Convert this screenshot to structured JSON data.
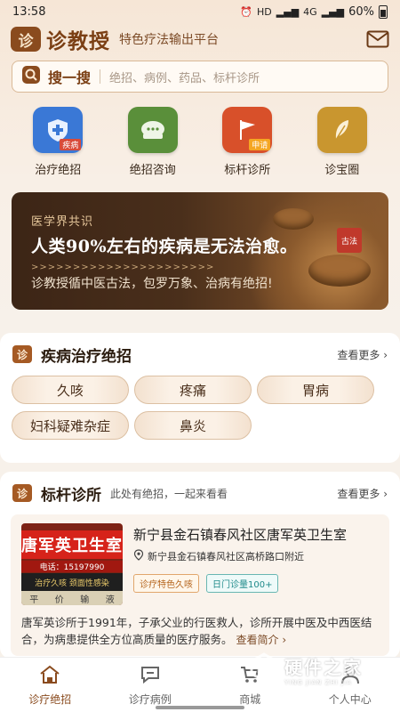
{
  "status_bar": {
    "time": "13:58",
    "net_hd": "HD",
    "net_4g": "4G",
    "battery": "60%"
  },
  "header": {
    "logo_char": "诊",
    "app_name": "诊教授",
    "slogan": "特色疗法输出平台"
  },
  "search": {
    "label": "搜一搜",
    "placeholder": "绝招、病例、药品、标杆诊所"
  },
  "quick_links": [
    {
      "label": "治疗绝招",
      "tag": "疾病",
      "color": "#3a78d6"
    },
    {
      "label": "绝招咨询",
      "color": "#5a8f3a"
    },
    {
      "label": "标杆诊所",
      "tag": "申请",
      "color": "#d8502a"
    },
    {
      "label": "诊宝圈",
      "color": "#c9962f"
    }
  ],
  "banner": {
    "tag": "医学界共识",
    "title": "人类90%左右的疾病是无法治愈。",
    "arrows": ">>>>>>>>>>>>>>>>>>>>>>",
    "subtitle": "诊教授循中医古法，包罗万象、治病有绝招!",
    "seal": "古法"
  },
  "disease_section": {
    "title": "疾病治疗绝招",
    "more": "查看更多",
    "items": [
      "久咳",
      "疼痛",
      "胃病",
      "妇科疑难杂症",
      "鼻炎"
    ]
  },
  "clinic_section": {
    "title": "标杆诊所",
    "subtitle": "此处有绝招，一起来看看",
    "more": "查看更多",
    "clinic": {
      "photo_sign": "唐军英卫生室",
      "photo_phone": "电话：15197990",
      "photo_row2": "治疗久咳 颈面性感染",
      "photo_row3": [
        "平",
        "价",
        "输",
        "液"
      ],
      "name": "新宁县金石镇春风社区唐军英卫生室",
      "address": "新宁县金石镇春风社区高桥路口附近",
      "badges": [
        "诊疗特色久咳",
        "日门诊量100+"
      ],
      "description": "唐军英诊所于1991年，子承父业的行医救人，诊所开展中医及中西医结合，为病患提供全方位高质量的医疗服务。",
      "intro_link": "查看简介"
    }
  },
  "tabbar": [
    {
      "label": "诊疗绝招",
      "active": true
    },
    {
      "label": "诊疗病例",
      "active": false
    },
    {
      "label": "商城",
      "active": false
    },
    {
      "label": "个人中心",
      "active": false
    }
  ],
  "watermark": {
    "text": "硬件之家",
    "sub": "YING JIAN ZHI JIA"
  }
}
